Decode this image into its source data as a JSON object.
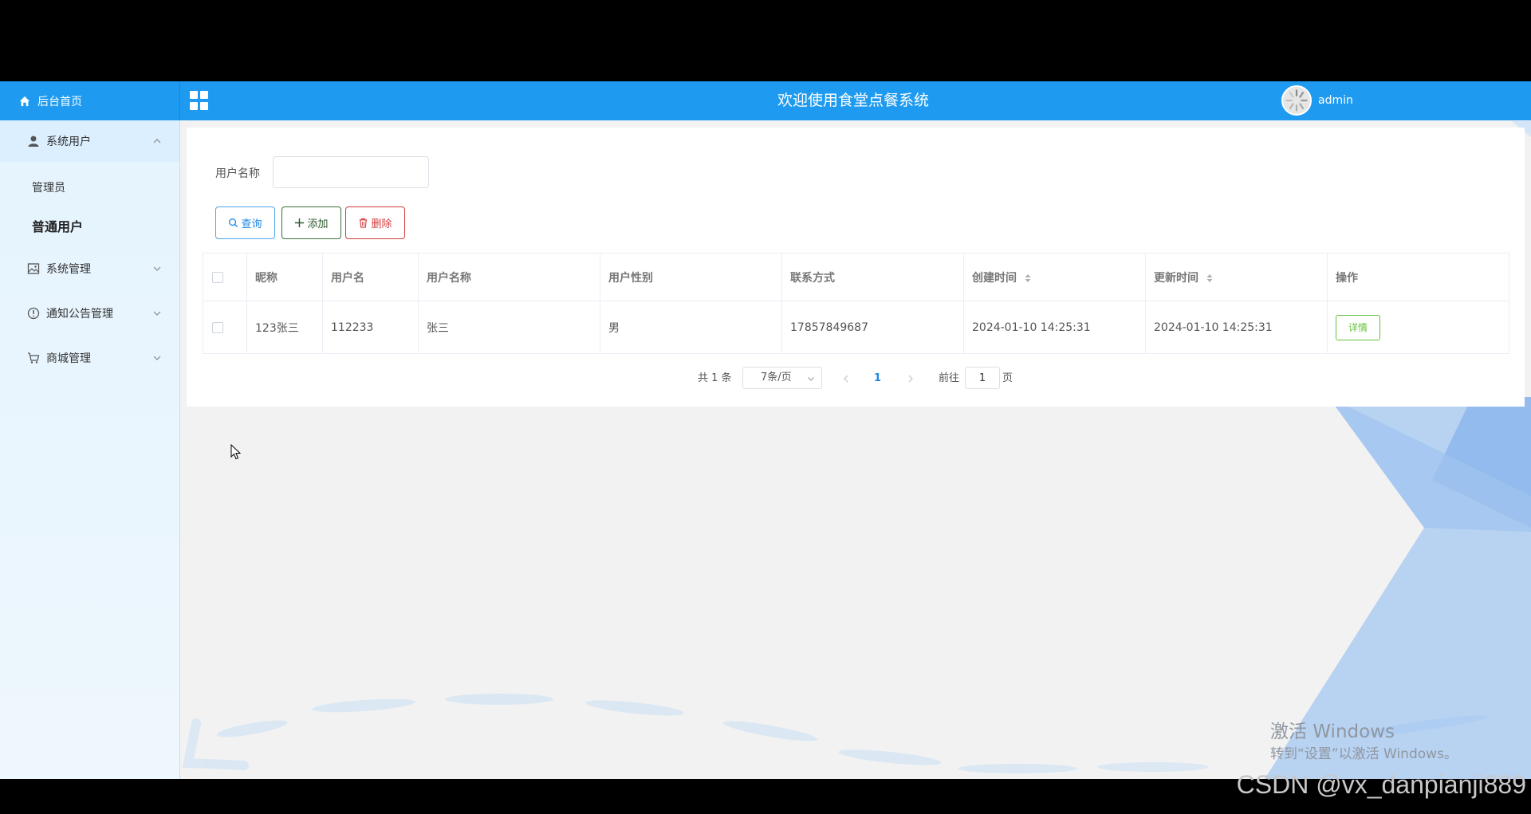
{
  "header": {
    "home_label": "后台首页",
    "app_title": "欢迎使用食堂点餐系统",
    "username": "admin"
  },
  "sidebar": {
    "items": [
      {
        "label": "系统用户",
        "icon": "user-icon",
        "expanded": true,
        "children": [
          {
            "label": "管理员"
          },
          {
            "label": "普通用户",
            "active": true
          }
        ]
      },
      {
        "label": "系统管理",
        "icon": "image-icon",
        "expanded": false
      },
      {
        "label": "通知公告管理",
        "icon": "info-circle-icon",
        "expanded": false
      },
      {
        "label": "商城管理",
        "icon": "cart-icon",
        "expanded": false
      }
    ]
  },
  "filter": {
    "label": "用户名称",
    "value": ""
  },
  "toolbar": {
    "search_label": "查询",
    "add_label": "添加",
    "delete_label": "删除"
  },
  "table": {
    "columns": [
      "昵称",
      "用户名",
      "用户名称",
      "用户性别",
      "联系方式",
      "创建时间",
      "更新时间",
      "操作"
    ],
    "rows": [
      {
        "nickname": "123张三",
        "username": "112233",
        "name": "张三",
        "gender": "男",
        "phone": "17857849687",
        "created": "2024-01-10 14:25:31",
        "updated": "2024-01-10 14:25:31",
        "action": "详情"
      }
    ]
  },
  "pagination": {
    "total_text": "共 1 条",
    "page_size": "7条/页",
    "current_page": "1",
    "goto_label": "前往",
    "goto_value": "1",
    "page_unit": "页"
  },
  "overlay": {
    "activate_title": "激活 Windows",
    "activate_sub": "转到“设置”以激活 Windows。",
    "csdn_watermark": "CSDN @vx_danpianji889"
  },
  "colors": {
    "header_bg": "#1e9bf0",
    "sidebar_bg": "#e5f4fe",
    "primary": "#1e88e5",
    "success": "#67c23a",
    "danger": "#d33a3a"
  }
}
